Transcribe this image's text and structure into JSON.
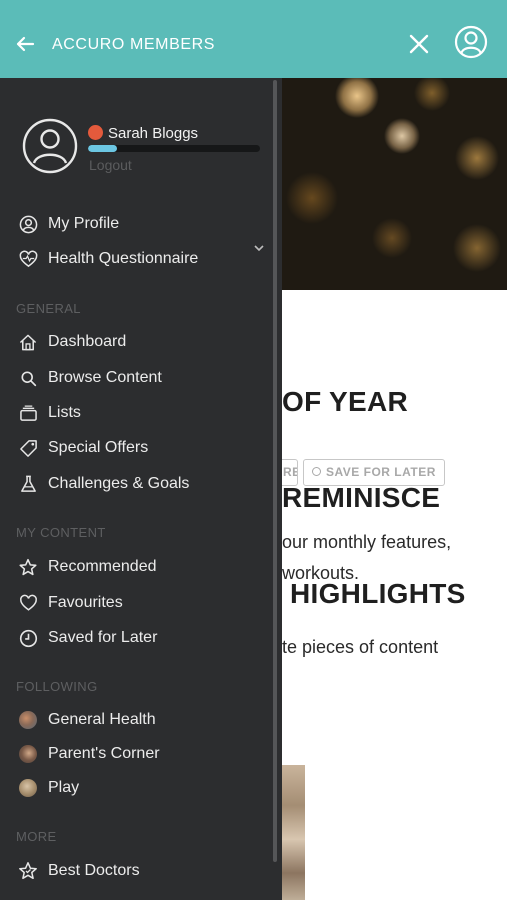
{
  "header": {
    "title": "ACCURO MEMBERS",
    "back_icon": "arrow-left-icon",
    "close_icon": "close-icon",
    "user_icon": "user-circle-icon",
    "background_color": "#5bbcb8"
  },
  "article": {
    "title_lines": [
      "OF YEAR",
      "REMINISCE",
      "HIGHLIGHTS"
    ],
    "chip_partial": "RE!",
    "save_label": "SAVE FOR LATER",
    "body_lines": [
      "our monthly features,",
      "workouts.",
      "te pieces of content"
    ]
  },
  "drawer": {
    "user": {
      "name": "Sarah Bloggs",
      "logout": "Logout",
      "status_color": "#e45a3c",
      "progress_fraction": 0.17
    },
    "profile_items": [
      {
        "label": "My Profile",
        "icon": "user-circle-icon"
      },
      {
        "label": "Health Questionnaire",
        "icon": "heart-pulse-icon"
      }
    ],
    "sections": {
      "general": "GENERAL",
      "my_content": "MY CONTENT",
      "following": "FOLLOWING",
      "more": "MORE"
    },
    "general_items": [
      {
        "label": "Dashboard",
        "icon": "home-icon"
      },
      {
        "label": "Browse Content",
        "icon": "search-icon"
      },
      {
        "label": "Lists",
        "icon": "lists-icon"
      },
      {
        "label": "Special Offers",
        "icon": "tag-icon"
      },
      {
        "label": "Challenges & Goals",
        "icon": "flask-icon"
      }
    ],
    "my_content_items": [
      {
        "label": "Recommended",
        "icon": "star-icon"
      },
      {
        "label": "Favourites",
        "icon": "heart-icon"
      },
      {
        "label": "Saved for Later",
        "icon": "clock-icon"
      }
    ],
    "following_items": [
      {
        "label": "General Health",
        "icon": "topic-avatar"
      },
      {
        "label": "Parent's Corner",
        "icon": "topic-avatar"
      },
      {
        "label": "Play",
        "icon": "topic-avatar"
      }
    ],
    "more_items": [
      {
        "label": "Best Doctors",
        "icon": "star-badge-icon"
      }
    ]
  }
}
